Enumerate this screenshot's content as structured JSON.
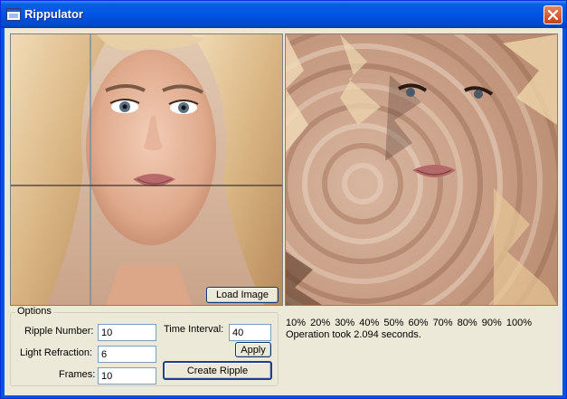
{
  "window": {
    "title": "Rippulator"
  },
  "buttons": {
    "load_image": "Load Image",
    "apply": "Apply",
    "create_ripple": "Create Ripple"
  },
  "options": {
    "group_label": "Options",
    "ripple_number_label": "Ripple Number:",
    "ripple_number_value": "10",
    "light_refraction_label": "Light Refraction:",
    "light_refraction_value": "6",
    "frames_label": "Frames:",
    "frames_value": "10",
    "time_interval_label": "Time Interval:",
    "time_interval_value": "40"
  },
  "progress_labels": [
    "10%",
    "20%",
    "30%",
    "40%",
    "50%",
    "60%",
    "70%",
    "80%",
    "90%",
    "100%"
  ],
  "status": {
    "message": "Operation took 2.094 seconds."
  },
  "icons": {
    "app": "app-window-icon",
    "close": "close-icon"
  }
}
